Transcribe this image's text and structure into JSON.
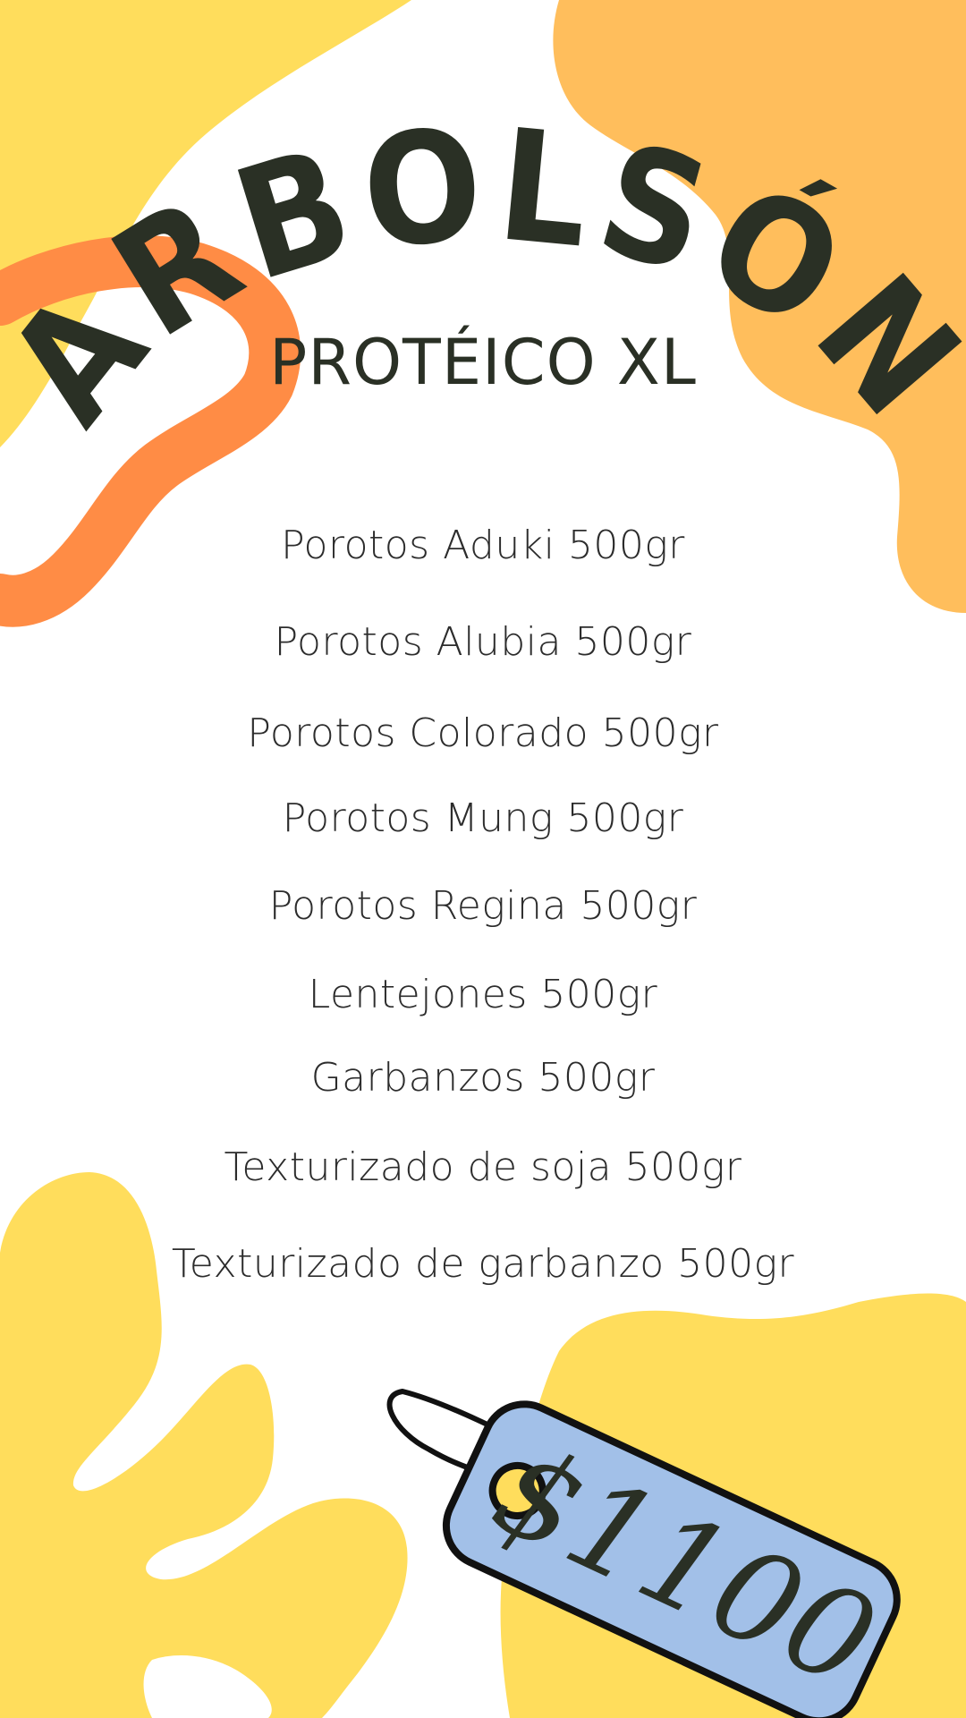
{
  "brand": {
    "title": "ARBOLSÓN",
    "subtitle": "PROTÉICO XL"
  },
  "items": [
    "Porotos Aduki 500gr",
    "Porotos Alubia 500gr",
    "Porotos Colorado 500gr",
    "Porotos Mung 500gr",
    "Porotos Regina 500gr",
    "Lentejones 500gr",
    "Garbanzos 500gr",
    "Texturizado de soja 500gr",
    "Texturizado de garbanzo 500gr"
  ],
  "price": "$1100",
  "colors": {
    "yellow": "#FFDD5C",
    "orange_light": "#FFBE5C",
    "orange": "#FF8C45",
    "tag_blue": "#A2C0E8",
    "text_dark": "#2A3025"
  }
}
